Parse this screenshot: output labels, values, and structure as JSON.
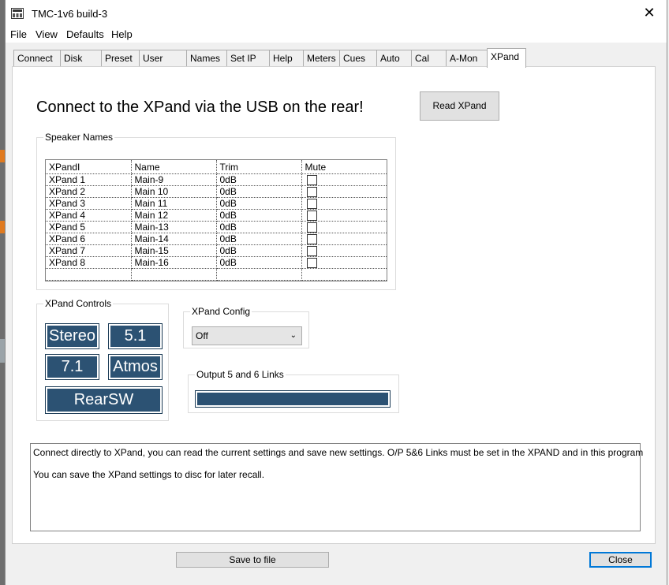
{
  "window": {
    "title": "TMC-1v6 build-3",
    "close_icon": "close-icon",
    "app_icon": "app-icon"
  },
  "menu": [
    "File",
    "View",
    "Defaults",
    "Help"
  ],
  "tabs": [
    "Connect",
    "Disk",
    "Preset",
    "User Keys",
    "Names",
    "Set IP",
    "Help",
    "Meters",
    "Cues",
    "Auto",
    "Cal",
    "A-Mon",
    "XPand"
  ],
  "active_tab": "XPand",
  "main": {
    "heading": "Connect to the XPand via the USB on the rear!",
    "read_button": "Read XPand"
  },
  "speaker_names": {
    "legend": "Speaker Names",
    "columns": [
      "XPandI",
      "Name",
      "Trim",
      "Mute"
    ],
    "rows": [
      {
        "id": "XPand 1",
        "name": "Main-9",
        "trim": "0dB",
        "mute": false
      },
      {
        "id": "XPand 2",
        "name": "Main 10",
        "trim": "0dB",
        "mute": false
      },
      {
        "id": "XPand 3",
        "name": "Main 11",
        "trim": "0dB",
        "mute": false
      },
      {
        "id": "XPand 4",
        "name": "Main 12",
        "trim": "0dB",
        "mute": false
      },
      {
        "id": "XPand 5",
        "name": "Main-13",
        "trim": "0dB",
        "mute": false
      },
      {
        "id": "XPand 6",
        "name": "Main-14",
        "trim": "0dB",
        "mute": false
      },
      {
        "id": "XPand 7",
        "name": "Main-15",
        "trim": "0dB",
        "mute": false
      },
      {
        "id": "XPand 8",
        "name": "Main-16",
        "trim": "0dB",
        "mute": false
      }
    ]
  },
  "controls": {
    "legend": "XPand Controls",
    "stereo": "Stereo",
    "five_one": "5.1",
    "seven_one": "7.1",
    "atmos": "Atmos",
    "rear_sw": "RearSW"
  },
  "config": {
    "legend": "XPand Config",
    "selected": "Off"
  },
  "links": {
    "legend": "Output 5 and 6 Links"
  },
  "info": {
    "line1": "Connect directly to  XPand, you can read the current settings and save new settings. O/P 5&6 Links must be set in the XPAND and in this program",
    "line2": "You can save the XPand settings to disc for later recall."
  },
  "footer": {
    "save_button": "Save to file",
    "close_button": "Close"
  },
  "colors": {
    "accent_blue": "#2c5273",
    "window_bg": "#f0f0f0",
    "focus_border": "#0078d7"
  }
}
